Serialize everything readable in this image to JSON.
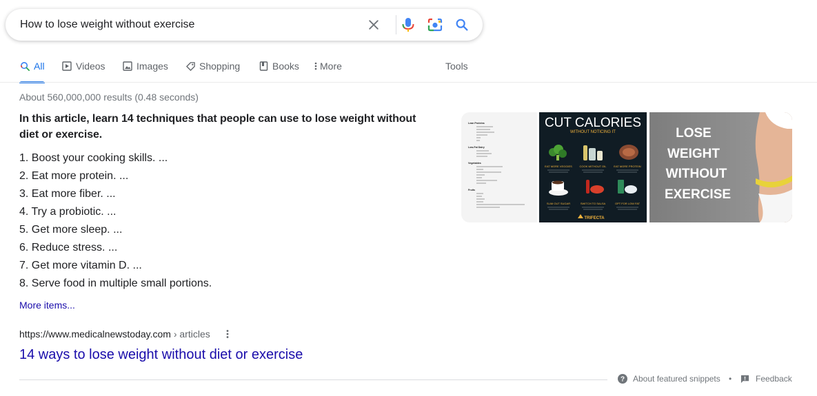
{
  "search": {
    "query": "How to lose weight without exercise"
  },
  "tabs": [
    {
      "label": "All",
      "icon": "search-icon"
    },
    {
      "label": "Videos",
      "icon": "play-icon"
    },
    {
      "label": "Images",
      "icon": "image-icon"
    },
    {
      "label": "Shopping",
      "icon": "tag-icon"
    },
    {
      "label": "Books",
      "icon": "book-icon"
    },
    {
      "label": "More",
      "icon": "kebab-icon"
    },
    {
      "label": "Tools"
    }
  ],
  "results": {
    "stats": "About 560,000,000 results (0.48 seconds)"
  },
  "snippet": {
    "heading": "In this article, learn 14 techniques that people can use to lose weight without diet or exercise.",
    "items": [
      "1. Boost your cooking skills. ...",
      "2. Eat more protein. ...",
      "3. Eat more fiber. ...",
      "4. Try a probiotic. ...",
      "5. Get more sleep. ...",
      "6. Reduce stress. ...",
      "7. Get more vitamin D. ...",
      "8. Serve food in multiple small portions."
    ],
    "more_label": "More items..."
  },
  "images": {
    "thumb1": {
      "sections": [
        "Lean Proteins",
        "Low-Fat Dairy",
        "Vegetables",
        "Fruits"
      ]
    },
    "thumb2": {
      "title": "CUT CALORIES",
      "subtitle": "WITHOUT NOTICING IT",
      "brand": "TRIFECTA",
      "labels": [
        "EAT MORE VEGGIES",
        "COOK WITHOUT OIL",
        "EAT MORE PROTEIN",
        "SLIM OUT SUGAR",
        "SWITCH TO SALSA",
        "OPT FOR LOW FAT"
      ]
    },
    "thumb3": {
      "line1": "LOSE",
      "line2": "WEIGHT",
      "line3": "WITHOUT",
      "line4": "EXERCISE"
    }
  },
  "source": {
    "url": "https://www.medicalnewstoday.com",
    "crumb": " › articles",
    "title": "14 ways to lose weight without diet or exercise"
  },
  "footer": {
    "about_label": "About featured snippets",
    "dot": "•",
    "feedback_label": "Feedback"
  },
  "colors": {
    "link_blue": "#1a0dab",
    "active_tab": "#1a73e8",
    "muted": "#70757a"
  }
}
